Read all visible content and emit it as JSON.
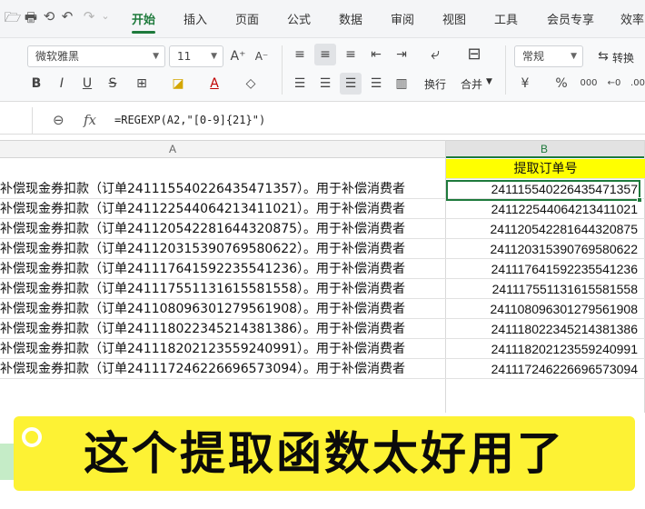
{
  "menu": {
    "quick_icons": [
      "🗁",
      "🖶",
      "⟲",
      "↶",
      "↷",
      "⌄"
    ],
    "tabs": [
      "开始",
      "插入",
      "页面",
      "公式",
      "数据",
      "审阅",
      "视图",
      "工具",
      "会员专享",
      "效率"
    ],
    "active_tab": "开始",
    "accent": "#1e7a3c"
  },
  "ribbon": {
    "font_name": "微软雅黑",
    "font_size": "11",
    "font_grow": "A⁺",
    "font_shrink": "A⁻",
    "bold": "B",
    "italic": "I",
    "underline": "U",
    "strike": "S",
    "border": "⊞",
    "fill": "◪",
    "font_color": "A",
    "clear": "◇",
    "wrap_label": "换行",
    "merge_label": "合并",
    "number_format": "常规",
    "convert_label": "转换",
    "currency": "¥",
    "percent": "%",
    "thousands": "000",
    "dec_add": "←0",
    "dec_remove": ".00"
  },
  "formula_bar": {
    "zoom_icon": "⊖",
    "fx": "fx",
    "formula": "=REGEXP(A2,\"[0-9]{21}\")"
  },
  "columns": {
    "A": "A",
    "B": "B"
  },
  "header_cell_b": "提取订单号",
  "rows": [
    {
      "a": "补偿现金券扣款（订单241115540226435471357）。用于补偿消费者",
      "b": "241115540226435471357"
    },
    {
      "a": "补偿现金券扣款（订单241122544064213411021）。用于补偿消费者",
      "b": "241122544064213411021"
    },
    {
      "a": "补偿现金券扣款（订单241120542281644320875）。用于补偿消费者",
      "b": "241120542281644320875"
    },
    {
      "a": "补偿现金券扣款（订单241120315390769580622）。用于补偿消费者",
      "b": "241120315390769580622"
    },
    {
      "a": "补偿现金券扣款（订单241117641592235541236）。用于补偿消费者",
      "b": "241117641592235541236"
    },
    {
      "a": "补偿现金券扣款（订单241117551131615581558）。用于补偿消费者",
      "b": "241117551131615581558"
    },
    {
      "a": "补偿现金券扣款（订单241108096301279561908）。用于补偿消费者",
      "b": "241108096301279561908"
    },
    {
      "a": "补偿现金券扣款（订单241118022345214381386）。用于补偿消费者",
      "b": "241118022345214381386"
    },
    {
      "a": "补偿现金券扣款（订单241118202123559240991）。用于补偿消费者",
      "b": "241118202123559240991"
    },
    {
      "a": "补偿现金券扣款（订单241117246226696573094）。用于补偿消费者",
      "b": "241117246226696573094"
    }
  ],
  "caption": "这个提取函数太好用了",
  "colors": {
    "highlight_yellow": "#ffff00",
    "caption_yellow": "#fdf234",
    "selection": "#1e7a3c"
  }
}
